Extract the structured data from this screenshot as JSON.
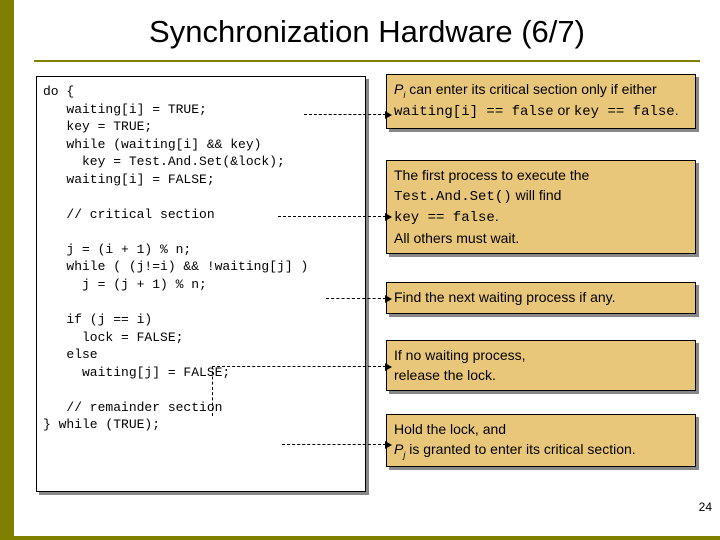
{
  "title": "Synchronization Hardware (6/7)",
  "code": "do {\n   waiting[i] = TRUE;\n   key = TRUE;\n   while (waiting[i] && key)\n     key = Test.And.Set(&lock);\n   waiting[i] = FALSE;\n\n   // critical section\n\n   j = (i + 1) % n;\n   while ( (j!=i) && !waiting[j] )\n     j = (j + 1) % n;\n\n   if (j == i)\n     lock = FALSE;\n   else\n     waiting[j] = FALSE;\n\n   // remainder section\n} while (TRUE);",
  "notes": {
    "n1_a": "P",
    "n1_sub": "i",
    "n1_b": " can enter its critical section only if either ",
    "n1_c": "waiting[i] == false",
    "n1_d": " or ",
    "n1_e": "key == false",
    "n1_f": ".",
    "n2_a": "The first process to execute the ",
    "n2_b": "Test.And.Set()",
    "n2_c": " will find ",
    "n2_d": "key == false",
    "n2_e": ".",
    "n2_f": "All others must wait.",
    "n3": "Find the next waiting process if any.",
    "n4_a": "If no waiting process,",
    "n4_b": "release the lock.",
    "n5_a": "Hold the lock, and",
    "n5_b1": "P",
    "n5_sub": "j",
    "n5_b2": " is granted to enter its critical section."
  },
  "pagenum": "24"
}
